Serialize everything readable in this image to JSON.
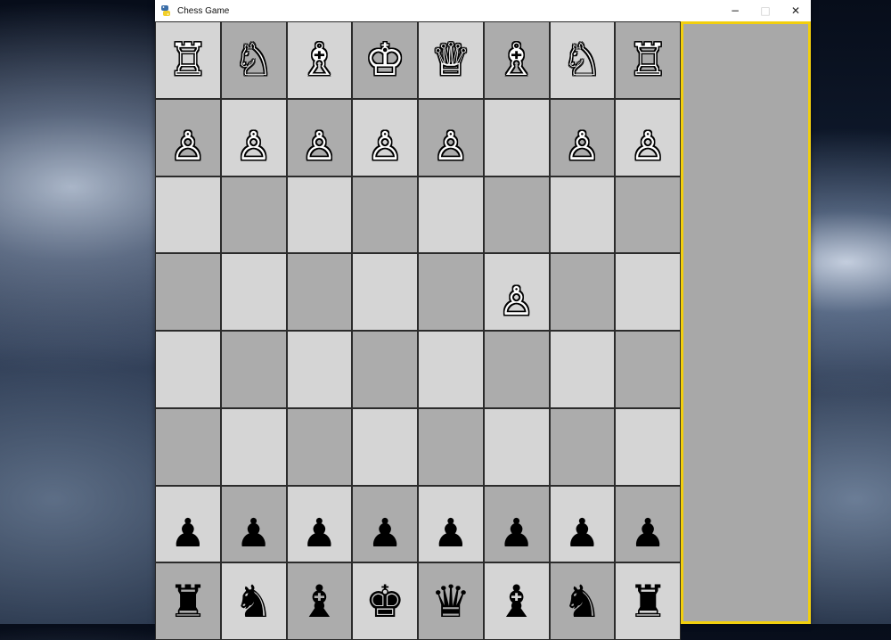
{
  "window": {
    "title": "Chess Game",
    "minimize_label": "−",
    "maximize_label": "□",
    "close_label": "✕"
  },
  "colors": {
    "light_square": "#d5d5d5",
    "dark_square": "#acacac",
    "panel_border": "#f2cf0d",
    "panel_background": "#a8a8a8"
  },
  "board": {
    "rows": [
      [
        {
          "p": "rook",
          "c": "white"
        },
        {
          "p": "knight",
          "c": "white"
        },
        {
          "p": "bishop",
          "c": "white"
        },
        {
          "p": "king",
          "c": "white"
        },
        {
          "p": "queen",
          "c": "white"
        },
        {
          "p": "bishop",
          "c": "white"
        },
        {
          "p": "knight",
          "c": "white"
        },
        {
          "p": "rook",
          "c": "white"
        }
      ],
      [
        {
          "p": "pawn",
          "c": "white"
        },
        {
          "p": "pawn",
          "c": "white"
        },
        {
          "p": "pawn",
          "c": "white"
        },
        {
          "p": "pawn",
          "c": "white"
        },
        {
          "p": "pawn",
          "c": "white"
        },
        null,
        {
          "p": "pawn",
          "c": "white"
        },
        {
          "p": "pawn",
          "c": "white"
        }
      ],
      [
        null,
        null,
        null,
        null,
        null,
        null,
        null,
        null
      ],
      [
        null,
        null,
        null,
        null,
        null,
        {
          "p": "pawn",
          "c": "white"
        },
        null,
        null
      ],
      [
        null,
        null,
        null,
        null,
        null,
        null,
        null,
        null
      ],
      [
        null,
        null,
        null,
        null,
        null,
        null,
        null,
        null
      ],
      [
        {
          "p": "pawn",
          "c": "black"
        },
        {
          "p": "pawn",
          "c": "black"
        },
        {
          "p": "pawn",
          "c": "black"
        },
        {
          "p": "pawn",
          "c": "black"
        },
        {
          "p": "pawn",
          "c": "black"
        },
        {
          "p": "pawn",
          "c": "black"
        },
        {
          "p": "pawn",
          "c": "black"
        },
        {
          "p": "pawn",
          "c": "black"
        }
      ],
      [
        {
          "p": "rook",
          "c": "black"
        },
        {
          "p": "knight",
          "c": "black"
        },
        {
          "p": "bishop",
          "c": "black"
        },
        {
          "p": "king",
          "c": "black"
        },
        {
          "p": "queen",
          "c": "black"
        },
        {
          "p": "bishop",
          "c": "black"
        },
        {
          "p": "knight",
          "c": "black"
        },
        {
          "p": "rook",
          "c": "black"
        }
      ]
    ]
  }
}
